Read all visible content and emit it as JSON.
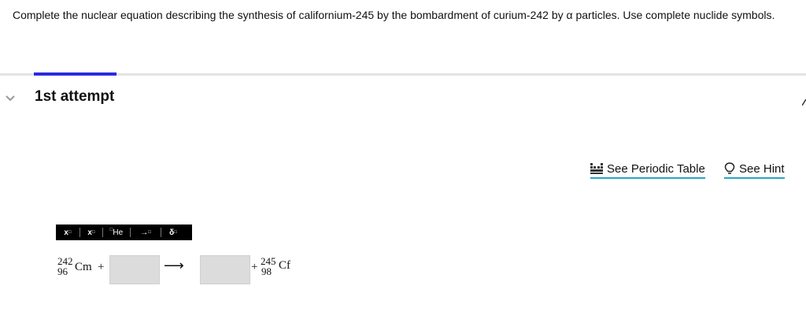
{
  "question": {
    "text": "Complete the nuclear equation describing the synthesis of californium-245 by the bombardment of curium-242 by α particles. Use complete nuclide symbols."
  },
  "attempt": {
    "label": "1st attempt"
  },
  "links": {
    "periodic_table": "See Periodic Table",
    "hint": "See Hint"
  },
  "toolbar": {
    "superscript": "x",
    "subscript": "x",
    "nuclide": "He",
    "arrow": "→",
    "delta": "δ"
  },
  "equation": {
    "reactant": {
      "mass": "242",
      "atomic": "96",
      "symbol": "Cm"
    },
    "plus1": "+",
    "plus2": "+",
    "arrow": "⟶",
    "product": {
      "mass": "245",
      "atomic": "98",
      "symbol": "Cf"
    }
  },
  "colors": {
    "accent": "#2a2ae0",
    "link_underline": "#2aa3c7",
    "toolbar_bg": "#000000",
    "input_bg": "#dcdcdc"
  }
}
